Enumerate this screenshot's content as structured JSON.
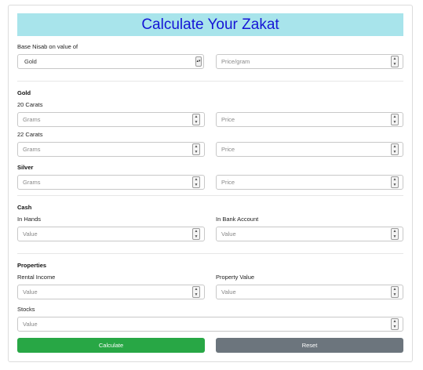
{
  "title": "Calculate Your Zakat",
  "nisab": {
    "label": "Base Nisab on value of",
    "selected": "Gold",
    "price_placeholder": "Price/gram"
  },
  "gold": {
    "heading": "Gold",
    "carat20_label": "20 Carats",
    "carat22_label": "22 Carats",
    "grams_placeholder": "Grams",
    "price_placeholder": "Price"
  },
  "silver": {
    "heading": "Silver",
    "grams_placeholder": "Grams",
    "price_placeholder": "Price"
  },
  "cash": {
    "heading": "Cash",
    "in_hands_label": "In Hands",
    "in_bank_label": "In Bank Account",
    "value_placeholder": "Value"
  },
  "properties": {
    "heading": "Properties",
    "rental_label": "Rental Income",
    "property_value_label": "Property Value",
    "stocks_label": "Stocks",
    "value_placeholder": "Value"
  },
  "buttons": {
    "calculate": "Calculate",
    "reset": "Reset"
  },
  "icons": {
    "spinner": "spinner-arrows-icon",
    "select": "chevron-updown-icon"
  }
}
